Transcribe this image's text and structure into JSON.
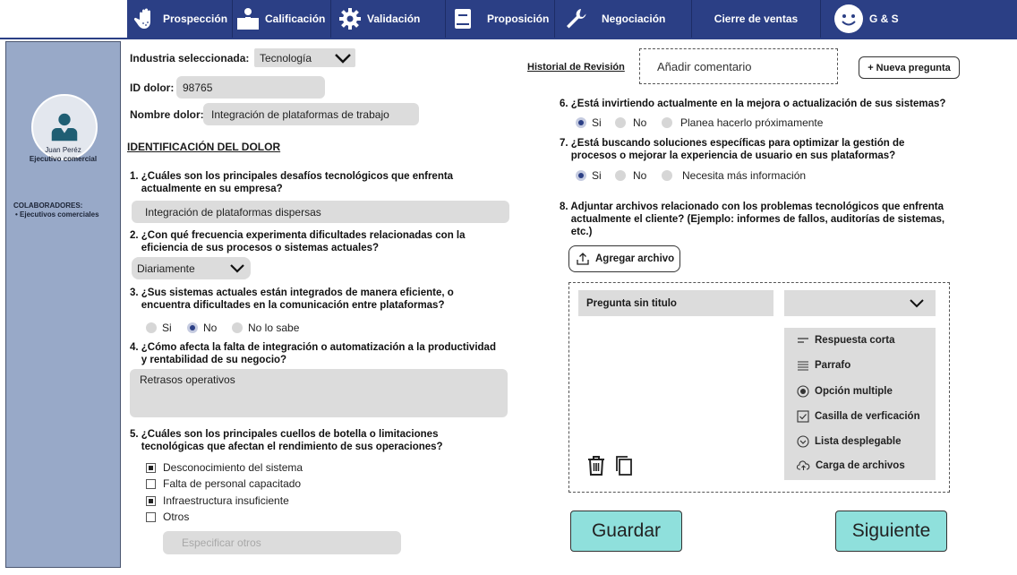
{
  "nav": {
    "items": [
      {
        "label": "Prospección",
        "icon": "hand-icon"
      },
      {
        "label": "Calificación",
        "icon": "person-podium-icon"
      },
      {
        "label": "Validación",
        "icon": "gear-icon"
      },
      {
        "label": "Proposición",
        "icon": "book-icon"
      },
      {
        "label": "Negociación",
        "icon": "wrench-icon"
      },
      {
        "label": "Cierre de ventas",
        "icon": ""
      },
      {
        "label": "G & S",
        "icon": "smiley-icon"
      }
    ]
  },
  "sidebar": {
    "user_name": "Juan Peréz",
    "user_role": "Ejecutivo comercial",
    "collab_title": "COLABORADORES:",
    "collab_item": "• Ejecutivos comerciales"
  },
  "form": {
    "industry_label": "Industria seleccionada:",
    "industry_value": "Tecnología",
    "id_label": "ID dolor:",
    "id_value": "98765",
    "name_label": "Nombre dolor:",
    "name_value": "Integración de plataformas de trabajo",
    "section_title": "IDENTIFICACIÓN DEL DOLOR",
    "q1": "1. ¿Cuáles son los principales desafíos tecnológicos que enfrenta\n    actualmente en su empresa?",
    "q1_answer": "Integración de plataformas dispersas",
    "q2": "2. ¿Con qué frecuencia experimenta dificultades relacionadas con la\n    eficiencia de sus procesos o sistemas actuales?",
    "q2_answer": "Diariamente",
    "q3": "3. ¿Sus sistemas actuales están integrados de manera eficiente, o\n    encuentra dificultades en la comunicación entre plataformas?",
    "q3_options": [
      "Si",
      "No",
      "No lo sabe"
    ],
    "q4": "4. ¿Cómo afecta la falta de integración o automatización a la productividad\n    y rentabilidad de su negocio?",
    "q4_answer": "Retrasos operativos",
    "q5": "5. ¿Cuáles son los principales cuellos de botella o limitaciones\n    tecnológicas que afectan el rendimiento de sus operaciones?",
    "q5_options": [
      "Desconocimiento del sistema",
      "Falta de personal capacitado",
      "Infraestructura insuficiente",
      "Otros"
    ],
    "q5_other_placeholder": "Especificar otros"
  },
  "right": {
    "history_link": "Historial de Revisión",
    "comment_placeholder": "Añadir comentario",
    "new_question": "+ Nueva pregunta",
    "q6": "6. ¿Está invirtiendo actualmente en la mejora o actualización de sus sistemas?",
    "q6_options": [
      "Si",
      "No",
      "Planea hacerlo próximamente"
    ],
    "q7": "7. ¿Está buscando soluciones específicas para optimizar la gestión de\n    procesos o mejorar la experiencia de usuario en sus plataformas?",
    "q7_options": [
      "Si",
      "No",
      "Necesita más información"
    ],
    "q8": "8. Adjuntar archivos relacionado con los problemas tecnológicos que enfrenta\n    actualmente el cliente? (Ejemplo: informes de fallos, auditorías de sistemas,\n    etc.)",
    "attach_label": "Agregar archivo",
    "builder": {
      "title": "Pregunta sin titulo",
      "types": [
        {
          "label": "Respuesta corta",
          "icon": "short-answer-icon"
        },
        {
          "label": "Parrafo",
          "icon": "paragraph-icon"
        },
        {
          "label": "Opción multiple",
          "icon": "radio-option-icon"
        },
        {
          "label": "Casilla de verficación",
          "icon": "checkbox-icon"
        },
        {
          "label": "Lista desplegable",
          "icon": "dropdown-list-icon"
        },
        {
          "label": "Carga de archivos",
          "icon": "cloud-upload-icon"
        }
      ]
    },
    "save": "Guardar",
    "next": "Siguiente"
  }
}
